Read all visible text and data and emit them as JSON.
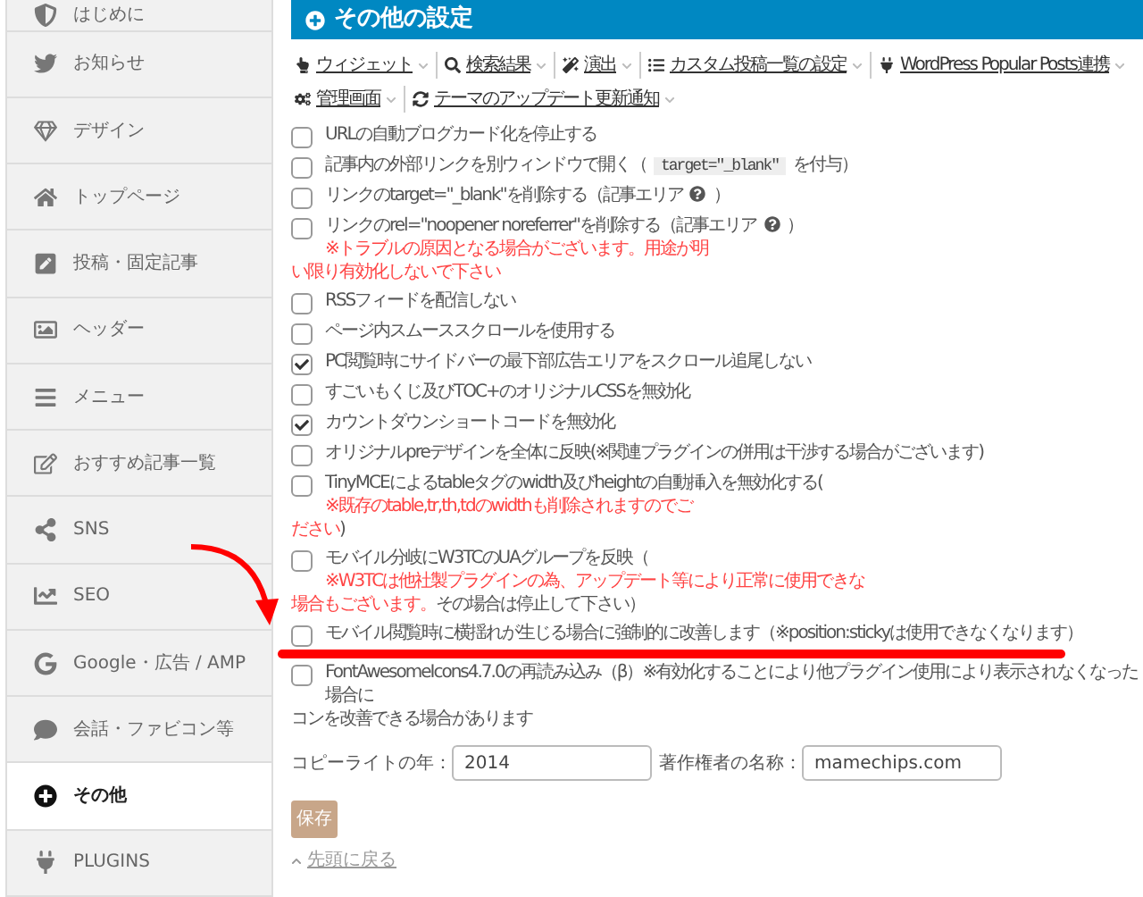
{
  "sidebar": {
    "items": [
      {
        "label": "はじめに",
        "selected": false
      },
      {
        "label": "お知らせ",
        "selected": false
      },
      {
        "label": "デザイン",
        "selected": false
      },
      {
        "label": "トップページ",
        "selected": false
      },
      {
        "label": "投稿・固定記事",
        "selected": false
      },
      {
        "label": "ヘッダー",
        "selected": false
      },
      {
        "label": "メニュー",
        "selected": false
      },
      {
        "label": "おすすめ記事一覧",
        "selected": false
      },
      {
        "label": "SNS",
        "selected": false
      },
      {
        "label": "SEO",
        "selected": false
      },
      {
        "label": "Google・広告 / AMP",
        "selected": false
      },
      {
        "label": "会話・ファビコン等",
        "selected": false
      },
      {
        "label": "その他",
        "selected": true
      },
      {
        "label": "PLUGINS",
        "selected": false
      }
    ]
  },
  "header": {
    "title": "その他の設定"
  },
  "toolbar": {
    "links": [
      {
        "label": "ウィジェット"
      },
      {
        "label": "検索結果"
      },
      {
        "label": "演出"
      },
      {
        "label": "カスタム投稿一覧の設定"
      },
      {
        "label": "WordPress Popular Posts連携"
      },
      {
        "label": "管理画面"
      },
      {
        "label": "テーマのアップデート更新通知"
      }
    ]
  },
  "options": [
    {
      "checked": false,
      "highlighted": false,
      "lines": [
        [
          {
            "kind": "text",
            "text": "URLの自動ブログカード化を停止する"
          }
        ]
      ]
    },
    {
      "checked": false,
      "highlighted": false,
      "lines": [
        [
          {
            "kind": "text",
            "text": "記事内の外部リンクを別ウィンドウで開く（"
          },
          {
            "kind": "code",
            "text": "target=\"_blank\""
          },
          {
            "kind": "text",
            "text": "を付与）"
          }
        ]
      ]
    },
    {
      "checked": false,
      "highlighted": false,
      "lines": [
        [
          {
            "kind": "text",
            "text": "リンクのtarget=\"_blank\"を削除する（記事エリア"
          },
          {
            "kind": "help"
          },
          {
            "kind": "text",
            "text": "）"
          }
        ]
      ]
    },
    {
      "checked": false,
      "highlighted": false,
      "lines": [
        [
          {
            "kind": "text",
            "text": "リンクのrel=\"noopener noreferrer\"を削除する（記事エリア"
          },
          {
            "kind": "help"
          },
          {
            "kind": "text",
            "text": "）"
          },
          {
            "kind": "note",
            "text": "※トラブルの原因となる場合がございます。用途が明"
          }
        ],
        [
          {
            "kind": "note",
            "text": "い限り有効化しないで下さい"
          }
        ]
      ]
    },
    {
      "checked": false,
      "highlighted": false,
      "lines": [
        [
          {
            "kind": "text",
            "text": "RSSフィードを配信しない"
          }
        ]
      ]
    },
    {
      "checked": false,
      "highlighted": false,
      "lines": [
        [
          {
            "kind": "text",
            "text": "ページ内スムーススクロールを使用する"
          }
        ]
      ]
    },
    {
      "checked": true,
      "highlighted": false,
      "lines": [
        [
          {
            "kind": "text",
            "text": "PC閲覧時にサイドバーの最下部広告エリアをスクロール追尾しない"
          }
        ]
      ]
    },
    {
      "checked": false,
      "highlighted": false,
      "lines": [
        [
          {
            "kind": "text",
            "text": "すごいもくじ及びTOC+のオリジナルCSSを無効化"
          }
        ]
      ]
    },
    {
      "checked": true,
      "highlighted": false,
      "lines": [
        [
          {
            "kind": "text",
            "text": "カウントダウンショートコードを無効化"
          }
        ]
      ]
    },
    {
      "checked": false,
      "highlighted": false,
      "lines": [
        [
          {
            "kind": "text",
            "text": "オリジナルpreデザインを全体に反映(※関連プラグインの併用は干渉する場合がございます)"
          }
        ]
      ]
    },
    {
      "checked": false,
      "highlighted": false,
      "lines": [
        [
          {
            "kind": "text",
            "text": "TinyMCEによるtableタグのwidth及びheightの自動挿入を無効化する("
          },
          {
            "kind": "note",
            "text": "※既存のtable,tr,th,tdのwidthも削除されますのでご"
          }
        ],
        [
          {
            "kind": "note",
            "text": "ださい"
          },
          {
            "kind": "text",
            "text": ")"
          }
        ]
      ]
    },
    {
      "checked": false,
      "highlighted": false,
      "lines": [
        [
          {
            "kind": "text",
            "text": "モバイル分岐にW3TCのUAグループを反映（"
          },
          {
            "kind": "note",
            "text": "※W3TCは他社製プラグインの為、アップデート等により正常に使用できな"
          }
        ],
        [
          {
            "kind": "note",
            "text": "場合もございます。"
          },
          {
            "kind": "text",
            "text": "その場合は停止して下さい）"
          }
        ]
      ]
    },
    {
      "checked": false,
      "highlighted": true,
      "lines": [
        [
          {
            "kind": "text",
            "text": "モバイル閲覧時に横揺れが生じる場合に強制的に改善します（※position:stickyは使用できなくなります）"
          }
        ]
      ]
    },
    {
      "checked": false,
      "highlighted": false,
      "lines": [
        [
          {
            "kind": "text",
            "text": "FontAwesomeIcons4.7.0の再読み込み（β）※有効化することにより他プラグイン使用により表示されなくなった場合に"
          }
        ],
        [
          {
            "kind": "text",
            "text": "コンを改善できる場合があります"
          }
        ]
      ]
    }
  ],
  "copyright": {
    "year_label": "コピーライトの年：",
    "year_value": "2014",
    "author_label": "著作権者の名称：",
    "author_value": "mamechips.com"
  },
  "save_button": {
    "label": "保存"
  },
  "back_to_top": {
    "label": "先頭に戻る"
  }
}
